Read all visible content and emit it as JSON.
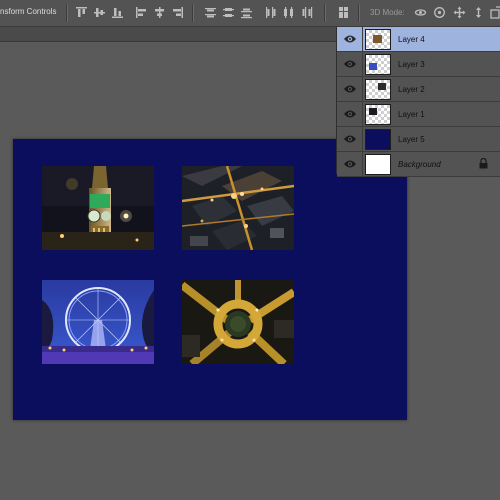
{
  "options_bar": {
    "transform_label": "nsform Controls",
    "mode_3d_label": "3D Mode:",
    "icons": [
      "align-top-edges-icon",
      "align-vertical-centers-icon",
      "align-bottom-edges-icon",
      "align-left-edges-icon",
      "align-horizontal-centers-icon",
      "align-right-edges-icon",
      "distribute-top-icon",
      "distribute-vertical-centers-icon",
      "distribute-bottom-icon",
      "distribute-left-icon",
      "distribute-horizontal-centers-icon",
      "distribute-right-icon",
      "auto-align-layers-icon",
      "rotate-3d-icon",
      "roll-3d-icon",
      "pan-3d-icon",
      "slide-3d-icon",
      "scale-3d-icon"
    ]
  },
  "colors": {
    "canvas_background": "#0b0e5c",
    "selected_layer": "#9eb3de",
    "workspace": "#5a5a5a"
  },
  "canvas": {
    "photos": [
      "Big Ben clock tower at night",
      "Aerial city streets at night",
      "London Eye ferris wheel at night",
      "Aerial roundabout at night"
    ]
  },
  "layers_panel": {
    "layers": [
      {
        "name": "Layer 4",
        "visible": true,
        "selected": true,
        "locked": false
      },
      {
        "name": "Layer 3",
        "visible": true,
        "selected": false,
        "locked": false
      },
      {
        "name": "Layer 2",
        "visible": true,
        "selected": false,
        "locked": false
      },
      {
        "name": "Layer 1",
        "visible": true,
        "selected": false,
        "locked": false
      },
      {
        "name": "Layer 5",
        "visible": true,
        "selected": false,
        "locked": false
      },
      {
        "name": "Background",
        "visible": true,
        "selected": false,
        "locked": true
      }
    ]
  }
}
